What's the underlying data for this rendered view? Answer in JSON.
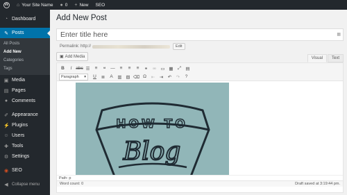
{
  "adminbar": {
    "site_name": "Your Site Name",
    "comments_count": "0",
    "new_label": "New",
    "seo_label": "SEO"
  },
  "sidebar": {
    "items": [
      {
        "label": "Dashboard",
        "icon": "dashboard-icon"
      },
      {
        "label": "Posts",
        "icon": "pin-icon"
      },
      {
        "label": "Media",
        "icon": "media-icon"
      },
      {
        "label": "Pages",
        "icon": "pages-icon"
      },
      {
        "label": "Comments",
        "icon": "comments-icon"
      },
      {
        "label": "Appearance",
        "icon": "brush-icon"
      },
      {
        "label": "Plugins",
        "icon": "plug-icon"
      },
      {
        "label": "Users",
        "icon": "user-icon"
      },
      {
        "label": "Tools",
        "icon": "wrench-icon"
      },
      {
        "label": "Settings",
        "icon": "settings-icon"
      },
      {
        "label": "SEO",
        "icon": "seo-icon"
      },
      {
        "label": "Collapse menu",
        "icon": "collapse-icon"
      }
    ],
    "posts_submenu": [
      "All Posts",
      "Add New",
      "Categories",
      "Tags"
    ],
    "active_color": "#0073aa"
  },
  "main": {
    "page_title": "Add New Post",
    "title_placeholder": "Enter title here",
    "permalink_label": "Permalink: http://",
    "permalink_edit": "Edit",
    "add_media": "Add Media",
    "tab_visual": "Visual",
    "tab_text": "Text",
    "format_select": "Paragraph",
    "image_text_top": "HOW TO",
    "image_text_bottom": "Blog",
    "image_bg": "#91b6b8",
    "path_label": "Path: p",
    "word_count": "Word count: 0",
    "draft_saved": "Draft saved at 3:19:44 pm."
  }
}
